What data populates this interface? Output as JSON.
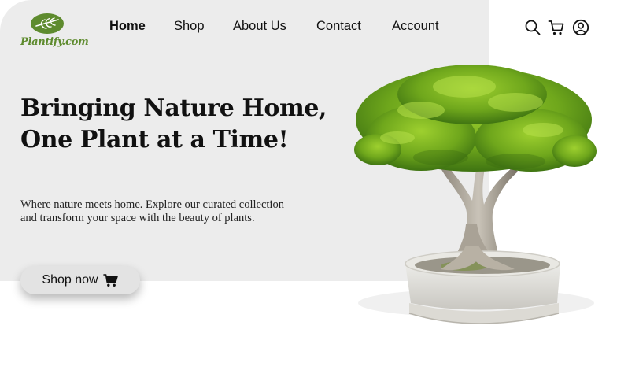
{
  "brand": {
    "name": "Plantify.com",
    "accent_color": "#5e8b2e"
  },
  "nav": {
    "items": [
      {
        "label": "Home",
        "active": true
      },
      {
        "label": "Shop",
        "active": false
      },
      {
        "label": "About Us",
        "active": false
      },
      {
        "label": "Contact",
        "active": false
      },
      {
        "label": "Account",
        "active": false
      }
    ]
  },
  "header_icons": [
    "search-icon",
    "cart-icon",
    "user-account-icon"
  ],
  "hero": {
    "headline_line1": "Bringing Nature Home,",
    "headline_line2": "One Plant at a Time!",
    "subcopy_line1": "Where nature meets home. Explore our curated collection",
    "subcopy_line2": "and transform your space with the beauty of plants.",
    "cta_label": "Shop now",
    "cta_icon": "cart-icon",
    "background_color": "#ececec"
  },
  "image": {
    "subject": "bonsai-tree-in-white-pot"
  }
}
